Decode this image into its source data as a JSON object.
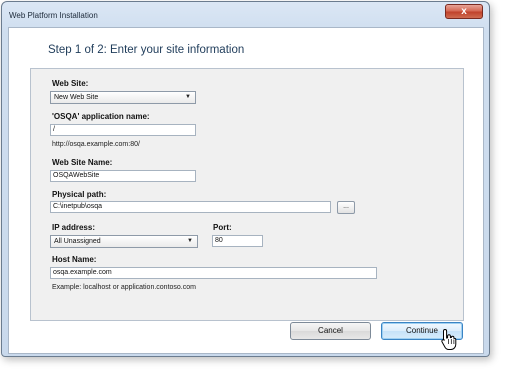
{
  "window": {
    "title": "Web Platform Installation",
    "close_glyph": "x"
  },
  "step_title": "Step 1 of 2: Enter your site information",
  "form": {
    "website_label": "Web Site:",
    "website_value": "New Web Site",
    "app_name_label": "'OSQA' application name:",
    "app_name_value": "/",
    "app_url": "http://osqa.example.com:80/",
    "site_name_label": "Web Site Name:",
    "site_name_value": "OSQAWebSite",
    "path_label": "Physical path:",
    "path_value": "C:\\inetpub\\osqa",
    "browse_label": "...",
    "ip_label": "IP address:",
    "ip_value": "All Unassigned",
    "port_label": "Port:",
    "port_value": "80",
    "host_label": "Host Name:",
    "host_value": "osqa.example.com",
    "host_example": "Example: localhost or application.contoso.com"
  },
  "buttons": {
    "cancel": "Cancel",
    "continue": "Continue"
  },
  "icons": {
    "dropdown": "chevron-down-icon",
    "cursor": "hand-pointer-icon"
  },
  "colors": {
    "close_button": "#c0432c",
    "step_title": "#1f3c5a",
    "primary_focus": "#3a84c4"
  }
}
